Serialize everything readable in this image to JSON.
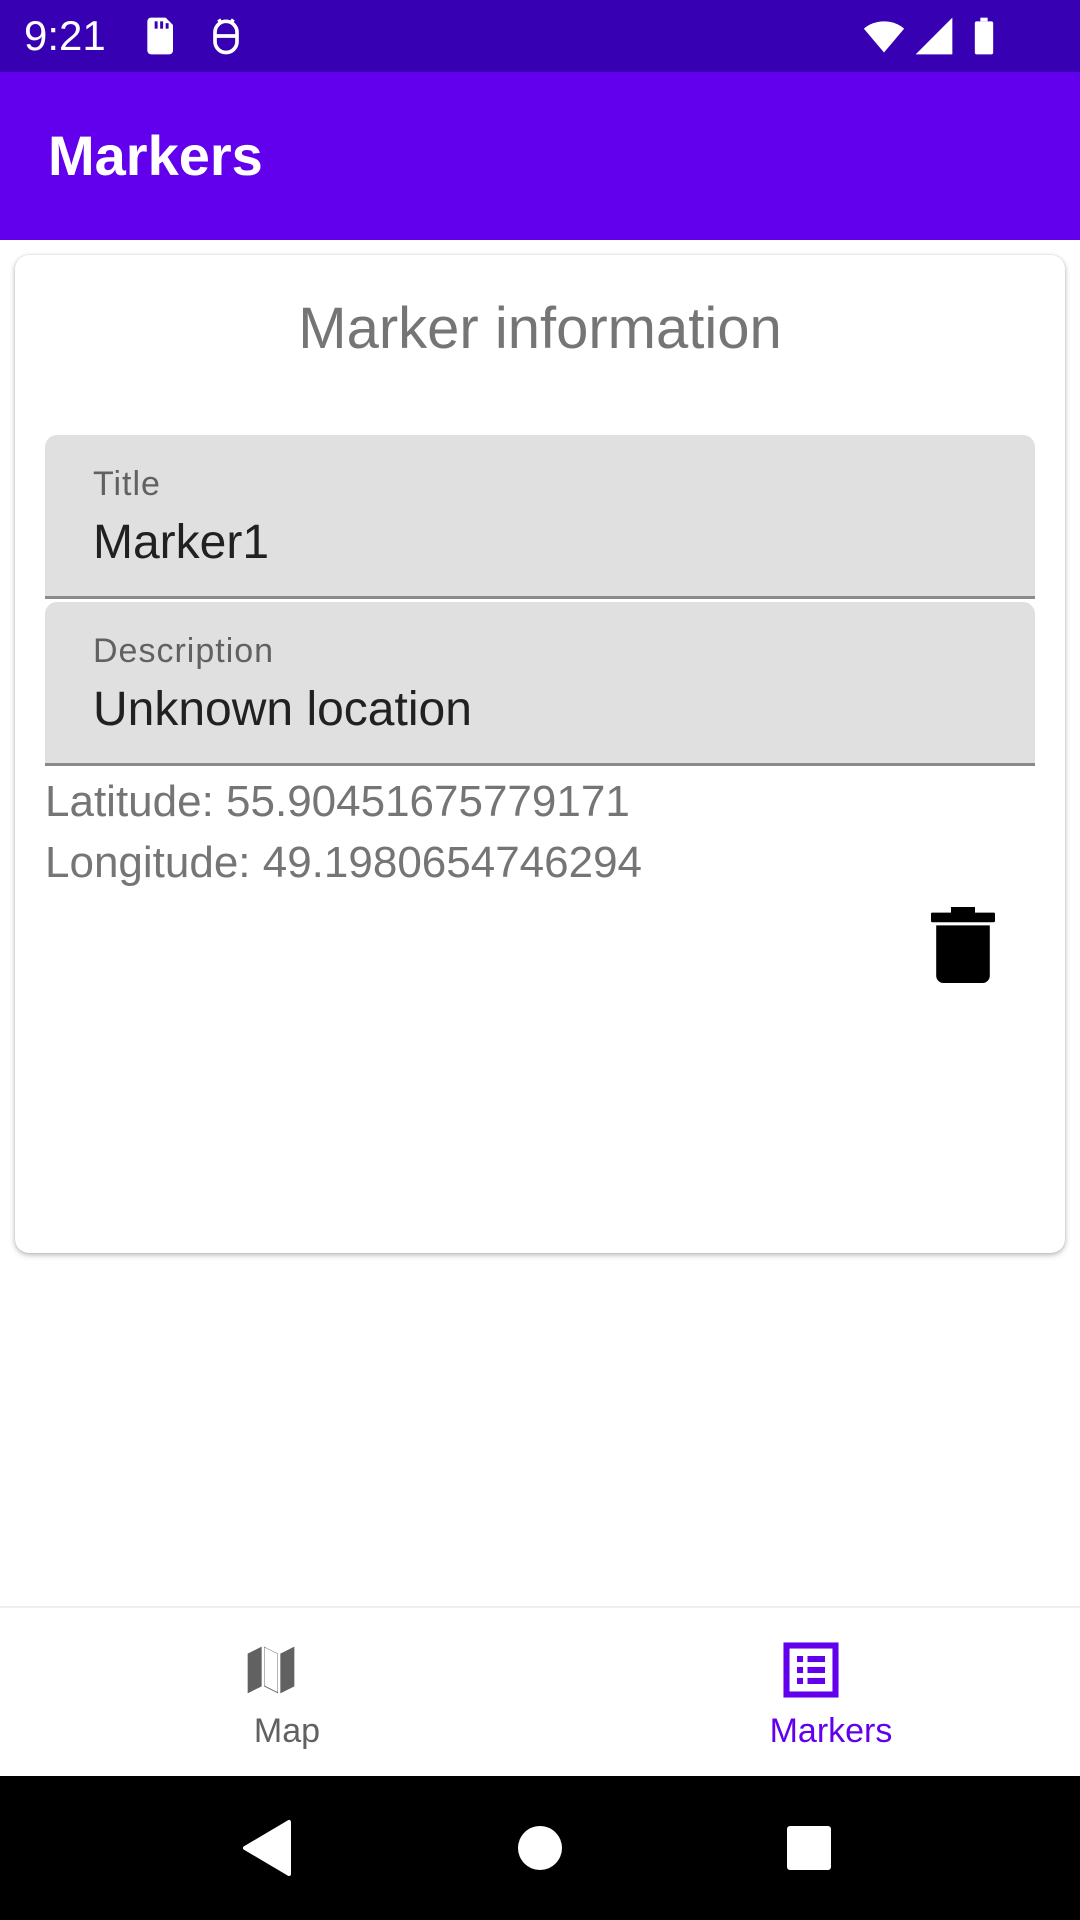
{
  "status_bar": {
    "time": "9:21",
    "icons_left": [
      "sd-card-icon",
      "android-debug-icon"
    ],
    "icons_right": [
      "wifi-icon",
      "cellular-signal-icon",
      "battery-icon"
    ]
  },
  "app_bar": {
    "title": "Markers"
  },
  "card": {
    "heading": "Marker information",
    "title_field": {
      "label": "Title",
      "value": "Marker1"
    },
    "description_field": {
      "label": "Description",
      "value": "Unknown location"
    },
    "latitude": "Latitude: 55.90451675779171",
    "longitude": "Longitude: 49.1980654746294",
    "delete_icon": "trash-icon"
  },
  "bottom_nav": {
    "items": [
      {
        "label": "Map",
        "icon": "map-icon",
        "selected": false
      },
      {
        "label": "Markers",
        "icon": "list-icon",
        "selected": true
      }
    ]
  },
  "system_nav": {
    "buttons": [
      "back-icon",
      "home-icon",
      "recents-icon"
    ]
  },
  "colors": {
    "status_bar": "#3700b3",
    "primary": "#6200ee",
    "field_background": "#e0e0e0",
    "secondary_text": "#757575"
  }
}
